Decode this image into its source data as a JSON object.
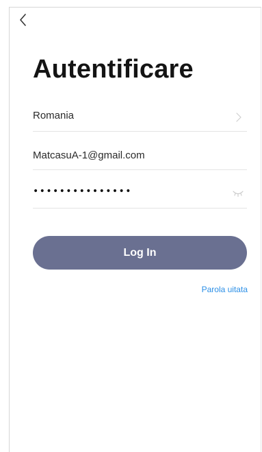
{
  "header": {
    "back_icon": "chevron-left-icon"
  },
  "page": {
    "title": "Autentificare"
  },
  "form": {
    "country": {
      "value": "Romania",
      "icon": "chevron-right-icon"
    },
    "email": {
      "value": "MatcasuA-1@gmail.com"
    },
    "password": {
      "masked_value": "•••••••••••••••",
      "toggle_icon": "eye-closed-icon"
    },
    "login_label": "Log In",
    "forgot_password_label": "Parola uitata"
  },
  "colors": {
    "button_background": "#6a7091",
    "link": "#2a8ee6",
    "title": "#141414",
    "divider": "#e4e4e4"
  }
}
